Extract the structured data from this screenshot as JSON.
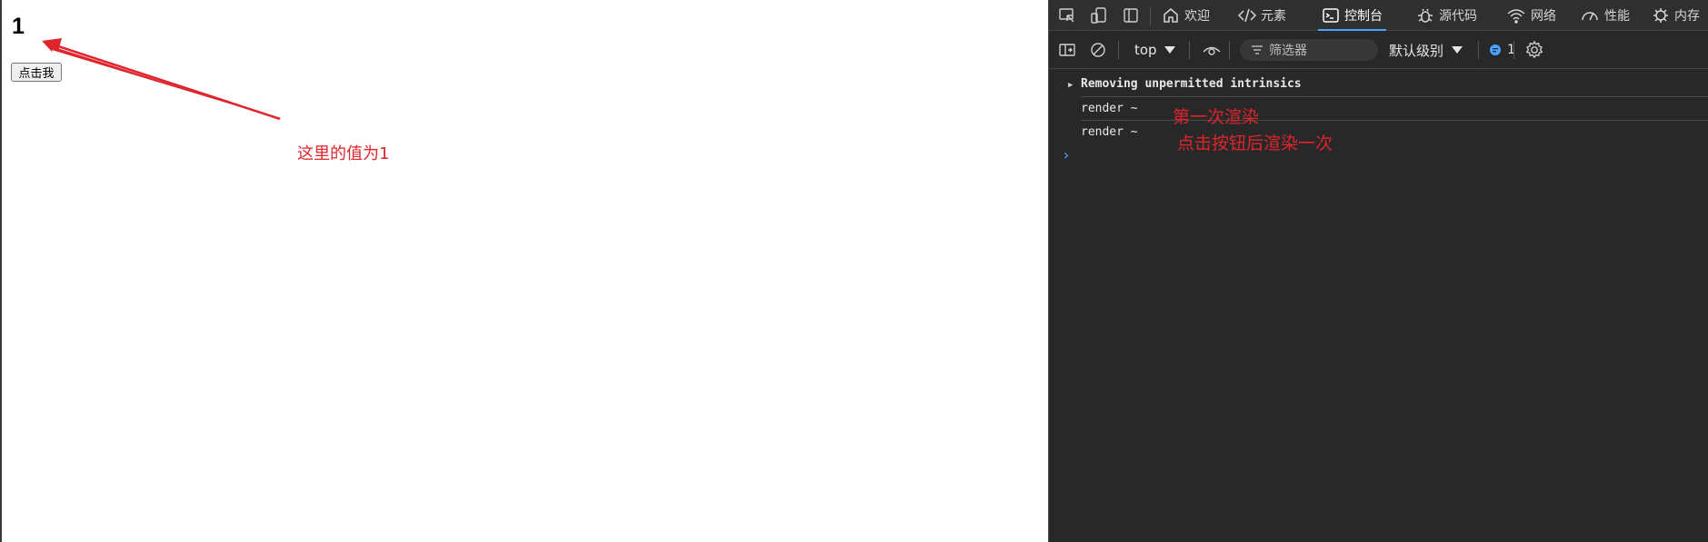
{
  "page": {
    "counter_value": "1",
    "button_label": "点击我",
    "annotation_value_note": "这里的值为1"
  },
  "devtools": {
    "tabs": [
      {
        "label": "欢迎",
        "icon": "home-icon"
      },
      {
        "label": "元素",
        "icon": "code-icon"
      },
      {
        "label": "控制台",
        "icon": "console-icon",
        "active": true
      },
      {
        "label": "源代码",
        "icon": "bug-icon"
      },
      {
        "label": "网络",
        "icon": "wifi-icon"
      },
      {
        "label": "性能",
        "icon": "gauge-icon"
      },
      {
        "label": "内存",
        "icon": "memory-chip-icon"
      }
    ],
    "toolbar": {
      "context": "top",
      "filter_placeholder": "筛选器",
      "log_level": "默认级别",
      "issues_count": "1"
    },
    "console": {
      "messages": [
        "Removing unpermitted intrinsics",
        "render ~",
        "render ~"
      ],
      "annotation_first_render": "第一次渲染",
      "annotation_after_click": "点击按钮后渲染一次"
    },
    "accent_color": "#4aa3ff"
  },
  "annotation_color": "#e0242c"
}
